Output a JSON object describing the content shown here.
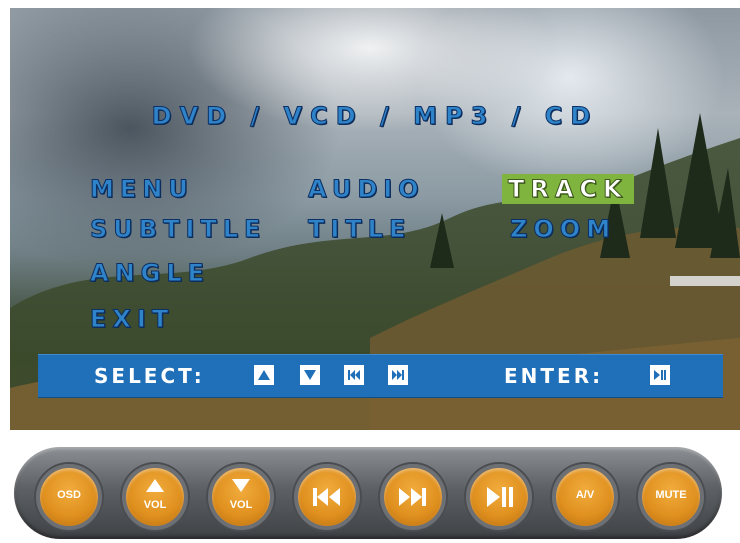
{
  "screen": {
    "title": "DVD / VCD / MP3 / CD",
    "menu_items": [
      {
        "label": "MENU",
        "selected": false
      },
      {
        "label": "AUDIO",
        "selected": false
      },
      {
        "label": "TRACK",
        "selected": true
      },
      {
        "label": "SUBTITLE",
        "selected": false
      },
      {
        "label": "TITLE",
        "selected": false
      },
      {
        "label": "ZOOM",
        "selected": false
      },
      {
        "label": "ANGLE",
        "selected": false
      },
      {
        "label": "EXIT",
        "selected": false
      }
    ],
    "bar": {
      "select_label": "SELECT:",
      "select_keys": [
        "up-icon",
        "down-icon",
        "previous-icon",
        "next-icon"
      ],
      "enter_label": "ENTER:",
      "enter_key": "play-pause-icon"
    }
  },
  "remote": {
    "buttons": [
      {
        "label": "OSD",
        "icon": null
      },
      {
        "label": "VOL",
        "icon": "volume-up-icon"
      },
      {
        "label": "VOL",
        "icon": "volume-down-icon"
      },
      {
        "label": "",
        "icon": "previous-icon"
      },
      {
        "label": "",
        "icon": "next-icon"
      },
      {
        "label": "",
        "icon": "play-pause-icon"
      },
      {
        "label": "A/V",
        "icon": null
      },
      {
        "label": "MUTE",
        "icon": null
      }
    ]
  },
  "colors": {
    "osd_text": "#2f83c9",
    "selected_highlight": "#7fb43e",
    "bar": "#1f6fb9",
    "remote_button": "#e0911f"
  }
}
